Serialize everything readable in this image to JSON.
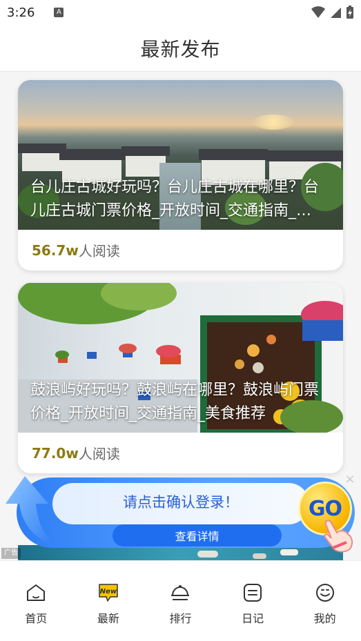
{
  "status_bar": {
    "time": "3:26",
    "notification_icon": "A"
  },
  "header": {
    "title": "最新发布"
  },
  "articles": [
    {
      "title": "台儿庄古城好玩吗？台儿庄古城在哪里？台儿庄古城门票价格_开放时间_交通指南_美食推荐",
      "count": "56.7w",
      "read_suffix": "人阅读"
    },
    {
      "title": "鼓浪屿好玩吗？鼓浪屿在哪里？鼓浪屿门票价格_开放时间_交通指南_美食推荐",
      "count": "77.0w",
      "read_suffix": "人阅读"
    }
  ],
  "ad": {
    "message": "请点击确认登录！",
    "button_label": "查看详情",
    "go_label": "GO",
    "close": "×",
    "tag": "广告",
    "colors": {
      "primary": "#2e7ef5",
      "button": "#1f6ef0",
      "go": "#f7b500"
    }
  },
  "nav": {
    "items": [
      {
        "label": "首页",
        "icon": "home-icon"
      },
      {
        "label": "最新",
        "icon": "new-badge-icon",
        "badge": "New"
      },
      {
        "label": "排行",
        "icon": "ranking-icon"
      },
      {
        "label": "日记",
        "icon": "diary-icon"
      },
      {
        "label": "我的",
        "icon": "profile-icon"
      }
    ]
  }
}
